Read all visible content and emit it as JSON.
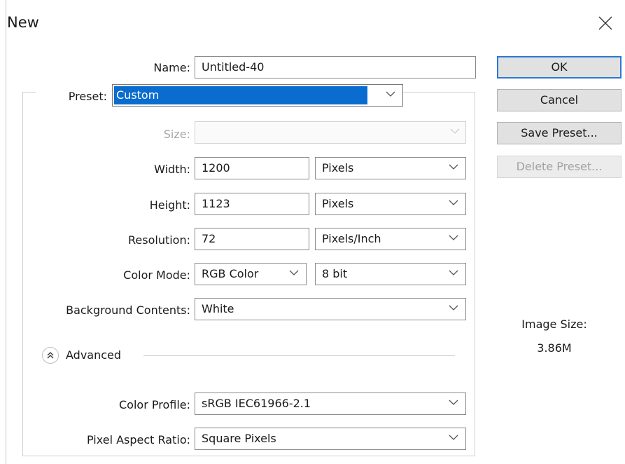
{
  "dialog": {
    "title": "New",
    "close_icon": "close-icon"
  },
  "form": {
    "name": {
      "label": "Name:",
      "value": "Untitled-40"
    },
    "preset": {
      "label": "Preset:",
      "value": "Custom"
    },
    "size": {
      "label": "Size:",
      "value": ""
    },
    "width": {
      "label": "Width:",
      "value": "1200",
      "unit": "Pixels"
    },
    "height": {
      "label": "Height:",
      "value": "1123",
      "unit": "Pixels"
    },
    "resolution": {
      "label": "Resolution:",
      "value": "72",
      "unit": "Pixels/Inch"
    },
    "color_mode": {
      "label": "Color Mode:",
      "value": "RGB Color",
      "depth": "8 bit"
    },
    "background": {
      "label": "Background Contents:",
      "value": "White"
    },
    "advanced": {
      "label": "Advanced",
      "icon": "chevron-double-up-icon"
    },
    "color_profile": {
      "label": "Color Profile:",
      "value": "sRGB IEC61966-2.1"
    },
    "pixel_aspect": {
      "label": "Pixel Aspect Ratio:",
      "value": "Square Pixels"
    }
  },
  "buttons": {
    "ok": "OK",
    "cancel": "Cancel",
    "save_preset": "Save Preset...",
    "delete_preset": "Delete Preset..."
  },
  "info": {
    "image_size_label": "Image Size:",
    "image_size_value": "3.86M"
  },
  "colors": {
    "selection": "#0a6ccf",
    "default_button_border": "#2a78d6"
  }
}
